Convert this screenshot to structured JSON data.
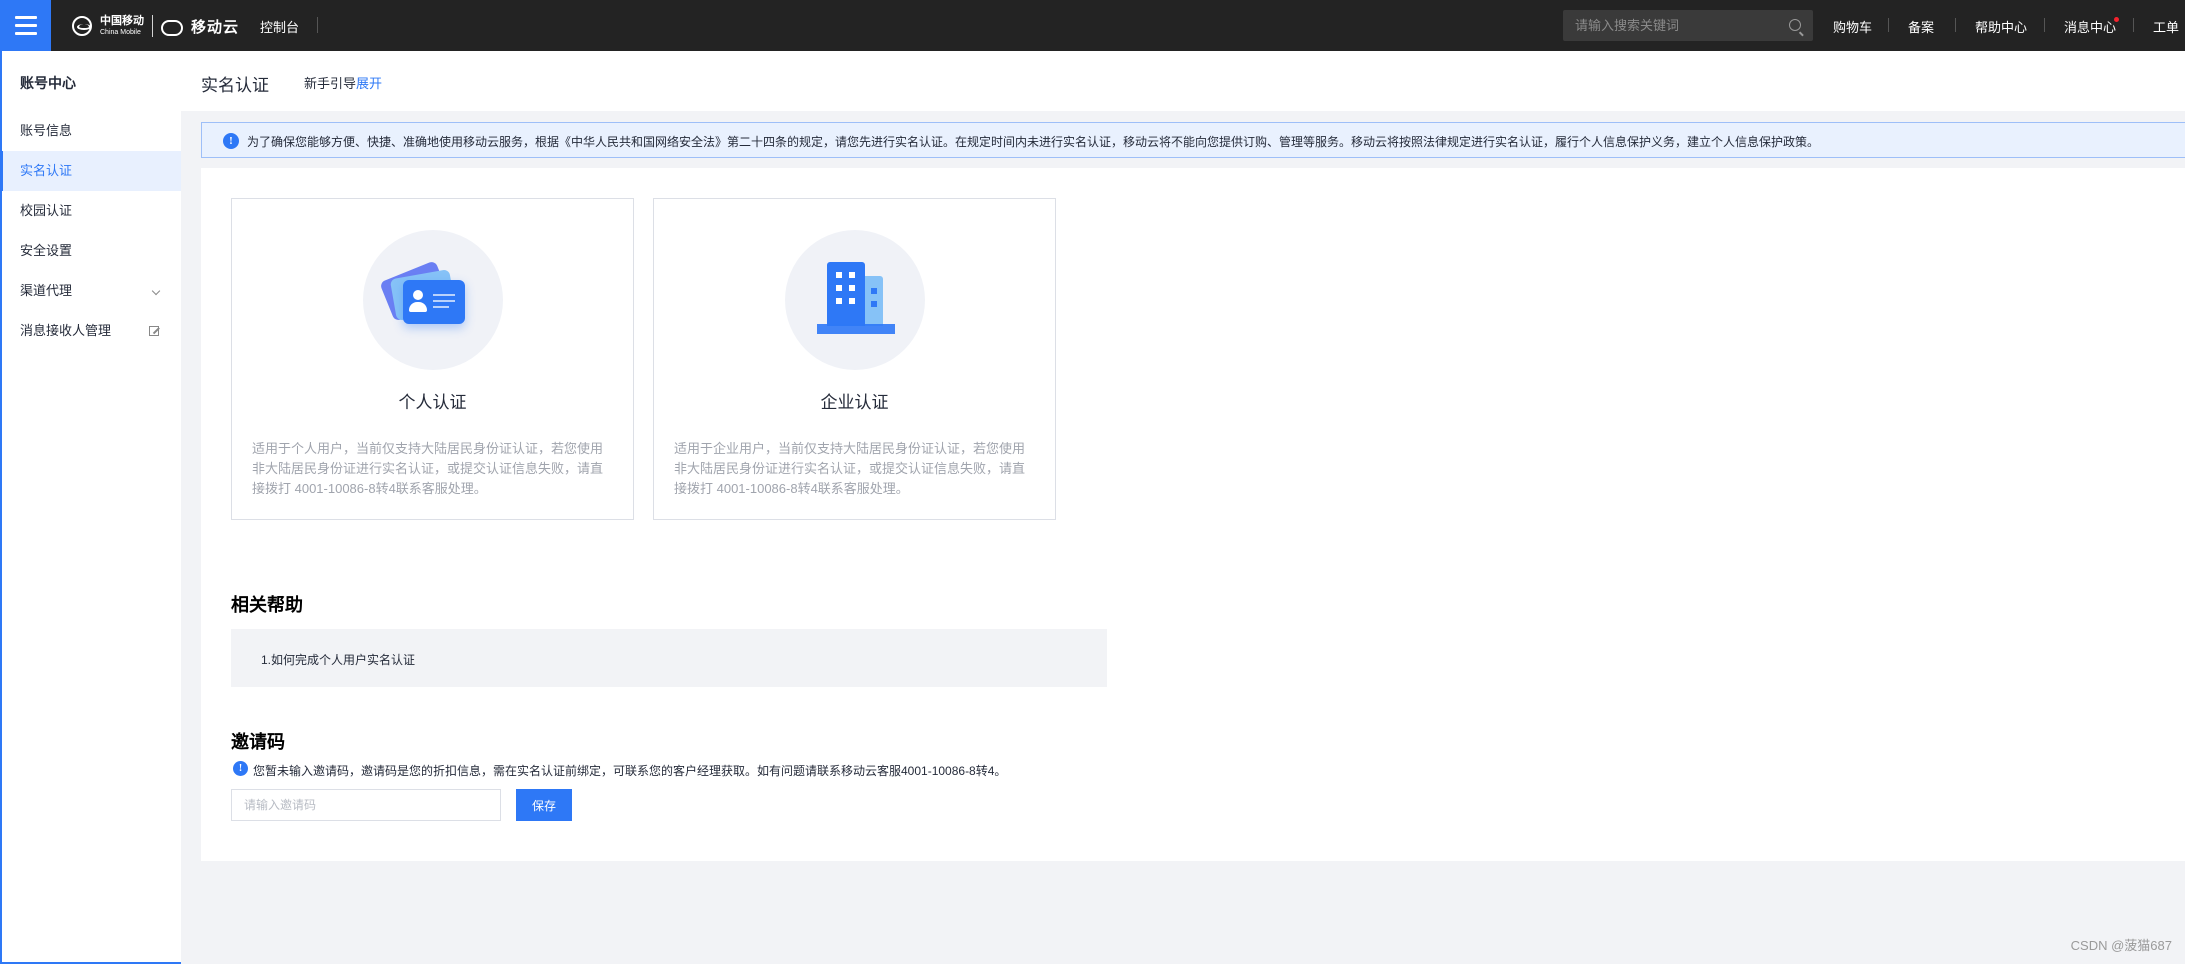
{
  "topbar": {
    "logo": {
      "cm_cn": "中国移动",
      "cm_en": "China Mobile",
      "brand": "移动云"
    },
    "console": "控制台",
    "search": {
      "placeholder": "请输入搜索关键词",
      "value": ""
    },
    "nav": {
      "cart": "购物车",
      "record": "备案",
      "help": "帮助中心",
      "messages": "消息中心",
      "tickets": "工单"
    },
    "accent": "#2e78f6"
  },
  "sidebar": {
    "title": "账号中心",
    "items": [
      {
        "label": "账号信息",
        "active": false,
        "icon": ""
      },
      {
        "label": "实名认证",
        "active": true,
        "icon": ""
      },
      {
        "label": "校园认证",
        "active": false,
        "icon": ""
      },
      {
        "label": "安全设置",
        "active": false,
        "icon": ""
      },
      {
        "label": "渠道代理",
        "active": false,
        "icon": "chevron-down-icon"
      },
      {
        "label": "消息接收人管理",
        "active": false,
        "icon": "external-link-icon"
      }
    ]
  },
  "header": {
    "title": "实名认证",
    "guide_label": "新手引导",
    "guide_link": "展开"
  },
  "notice": {
    "text": "为了确保您能够方便、快捷、准确地使用移动云服务，根据《中华人民共和国网络安全法》第二十四条的规定，请您先进行实名认证。在规定时间内未进行实名认证，移动云将不能向您提供订购、管理等服务。移动云将按照法律规定进行实名认证，履行个人信息保护义务，建立个人信息保护政策。"
  },
  "cards": [
    {
      "title": "个人认证",
      "icon": "id-card-icon",
      "description": "适用于个人用户，当前仅支持大陆居民身份证认证，若您使用非大陆居民身份证进行实名认证，或提交认证信息失败，请直接拨打 4001-10086-8转4联系客服处理。"
    },
    {
      "title": "企业认证",
      "icon": "building-icon",
      "description": "适用于企业用户，当前仅支持大陆居民身份证认证，若您使用非大陆居民身份证进行实名认证，或提交认证信息失败，请直接拨打 4001-10086-8转4联系客服处理。"
    }
  ],
  "help": {
    "title": "相关帮助",
    "items": [
      "1.如何完成个人用户实名认证"
    ]
  },
  "invite": {
    "title": "邀请码",
    "note": "您暂未输入邀请码，邀请码是您的折扣信息，需在实名认证前绑定，可联系您的客户经理获取。如有问题请联系移动云客服4001-10086-8转4。",
    "placeholder": "请输入邀请码",
    "value": "",
    "save": "保存"
  },
  "watermark": "CSDN @菠猫687"
}
